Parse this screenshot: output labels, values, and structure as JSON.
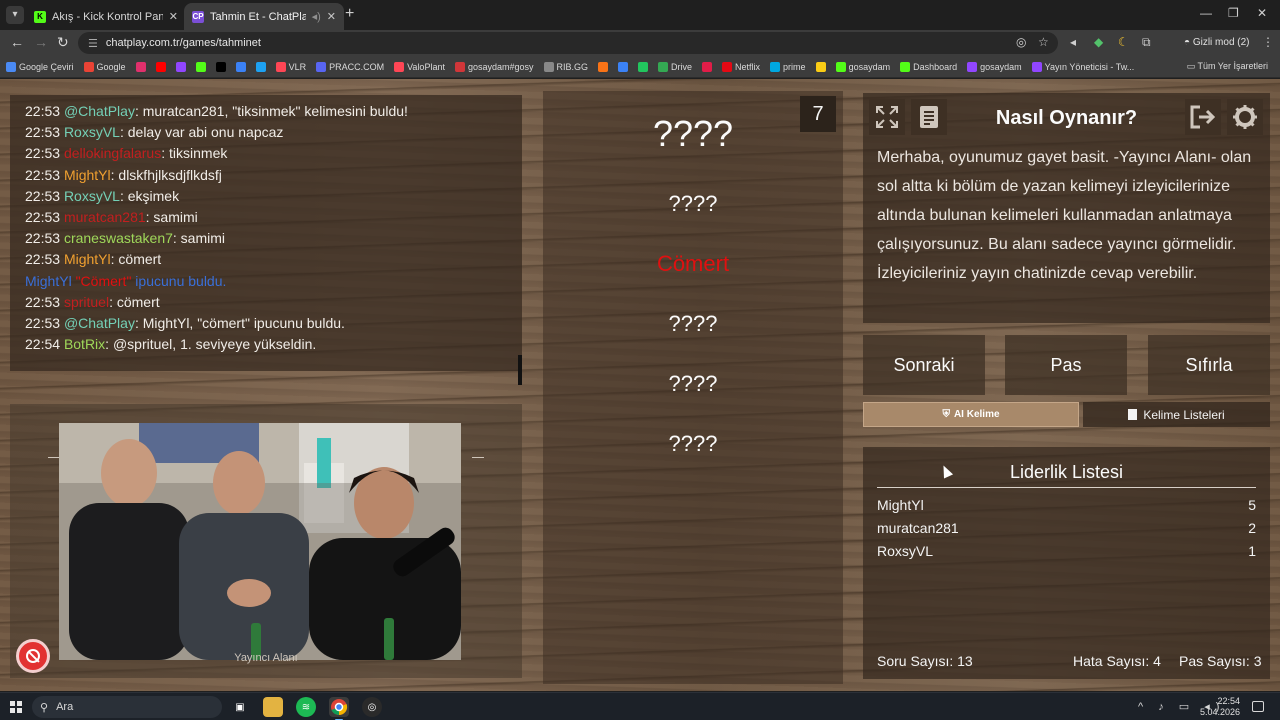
{
  "browser": {
    "tabs": [
      {
        "title": "Akış - Kick Kontrol Paneli",
        "favicon": "K",
        "favicon_color": "#53fc18",
        "active": false
      },
      {
        "title": "Tahmin Et - ChatPlay",
        "favicon": "CP",
        "favicon_color": "#7b4fd6",
        "active": true
      }
    ],
    "url": "chatplay.com.tr/games/tahminet",
    "incognito_label": "Gizli mod (2)",
    "bookmarks": [
      {
        "label": "Google Çeviri",
        "color": "#4a8af4"
      },
      {
        "label": "Google",
        "color": "#ea4335"
      },
      {
        "label": "",
        "color": "#e1306c"
      },
      {
        "label": "",
        "color": "#ff0000"
      },
      {
        "label": "",
        "color": "#9146ff"
      },
      {
        "label": "",
        "color": "#53fc18"
      },
      {
        "label": "",
        "color": "#000000"
      },
      {
        "label": "",
        "color": "#3b82f6"
      },
      {
        "label": "",
        "color": "#1da1f2"
      },
      {
        "label": "VLR",
        "color": "#ff4655"
      },
      {
        "label": "PRACC.COM",
        "color": "#5865f2"
      },
      {
        "label": "ValoPlant",
        "color": "#ff4655"
      },
      {
        "label": "gosaydam#gosy",
        "color": "#d13639"
      },
      {
        "label": "RIB.GG",
        "color": "#888888"
      },
      {
        "label": "",
        "color": "#f97316"
      },
      {
        "label": "",
        "color": "#3b82f6"
      },
      {
        "label": "",
        "color": "#22c55e"
      },
      {
        "label": "Drive",
        "color": "#34a853"
      },
      {
        "label": "",
        "color": "#e11d48"
      },
      {
        "label": "Netflix",
        "color": "#e50914"
      },
      {
        "label": "prime",
        "color": "#00a8e1"
      },
      {
        "label": "",
        "color": "#facc15"
      },
      {
        "label": "gosaydam",
        "color": "#53fc18"
      },
      {
        "label": "Dashboard",
        "color": "#53fc18"
      },
      {
        "label": "gosaydam",
        "color": "#9146ff"
      },
      {
        "label": "Yayın Yöneticisi - Tw...",
        "color": "#9146ff"
      }
    ],
    "all_bookmarks_label": "Tüm Yer İşaretleri"
  },
  "chat": {
    "messages": [
      {
        "time": "22:53",
        "user": "@ChatPlay",
        "user_color": "#74d0b6",
        "text": ": muratcan281, \"tiksinmek\" kelimesini buldu!"
      },
      {
        "time": "22:53",
        "user": "RoxsyVL",
        "user_color": "#74d0b6",
        "text": ": delay var abi onu napcaz"
      },
      {
        "time": "22:53",
        "user": "dellokingfalarus",
        "user_color": "#c21f1f",
        "text": ": tiksinmek"
      },
      {
        "time": "22:53",
        "user": "MightYl",
        "user_color": "#f0a030",
        "text": ": dlskfhjlksdjflkdsfj"
      },
      {
        "time": "22:53",
        "user": "RoxsyVL",
        "user_color": "#74d0b6",
        "text": ": ekşimek"
      },
      {
        "time": "22:53",
        "user": "muratcan281",
        "user_color": "#c21f1f",
        "text": ": samimi"
      },
      {
        "time": "22:53",
        "user": "craneswastaken7",
        "user_color": "#9fd85a",
        "text": ": samimi"
      },
      {
        "time": "22:53",
        "user": "MightYl",
        "user_color": "#f0a030",
        "text": ": cömert"
      },
      {
        "time": "",
        "user": "MightYl",
        "user_color": "#3a6fd8",
        "text": "",
        "highlight": "\"Cömert\"",
        "suffix": " ipucunu buldu."
      },
      {
        "time": "22:53",
        "user": "sprituel",
        "user_color": "#c21f1f",
        "text": ": cömert"
      },
      {
        "time": "22:53",
        "user": "@ChatPlay",
        "user_color": "#74d0b6",
        "text": ": MightYl, \"cömert\" ipucunu buldu."
      },
      {
        "time": "22:54",
        "user": "BotRix",
        "user_color": "#9fd85a",
        "text": ": @sprituel, 1. seviyeye yükseldin."
      }
    ]
  },
  "webcam": {
    "label": "Yayıncı Alanı"
  },
  "words": {
    "counter": "7",
    "items": [
      {
        "text": "????",
        "style": "big"
      },
      {
        "text": "????",
        "style": "mid"
      },
      {
        "text": "Cömert",
        "style": "found"
      },
      {
        "text": "????",
        "style": "mid"
      },
      {
        "text": "????",
        "style": "mid"
      },
      {
        "text": "????",
        "style": "mid"
      }
    ]
  },
  "info": {
    "title": "Nasıl Oynanır?",
    "text": "Merhaba, oyunumuz gayet basit. -Yayıncı Alanı- olan sol altta ki bölüm de yazan kelimeyi izleyicilerinize altında bulunan kelimeleri kullanmadan anlatmaya çalışıyorsunuz. Bu alanı sadece yayıncı görmelidir. İzleyicileriniz yayın chatinizde cevap verebilir."
  },
  "controls": {
    "next": "Sonraki",
    "pass": "Pas",
    "reset": "Sıfırla",
    "ai_word": "AI Kelime",
    "word_lists": "Kelime Listeleri"
  },
  "leaderboard": {
    "title": "Liderlik Listesi",
    "rows": [
      {
        "name": "MightYl",
        "score": "5"
      },
      {
        "name": "muratcan281",
        "score": "2"
      },
      {
        "name": "RoxsyVL",
        "score": "1"
      }
    ],
    "questions": "Soru Sayısı: 13",
    "errors": "Hata Sayısı: 4",
    "passes": "Pas Sayısı: 3"
  },
  "taskbar": {
    "search_placeholder": "Ara",
    "time": "22:54",
    "date": "5.04.2026"
  }
}
